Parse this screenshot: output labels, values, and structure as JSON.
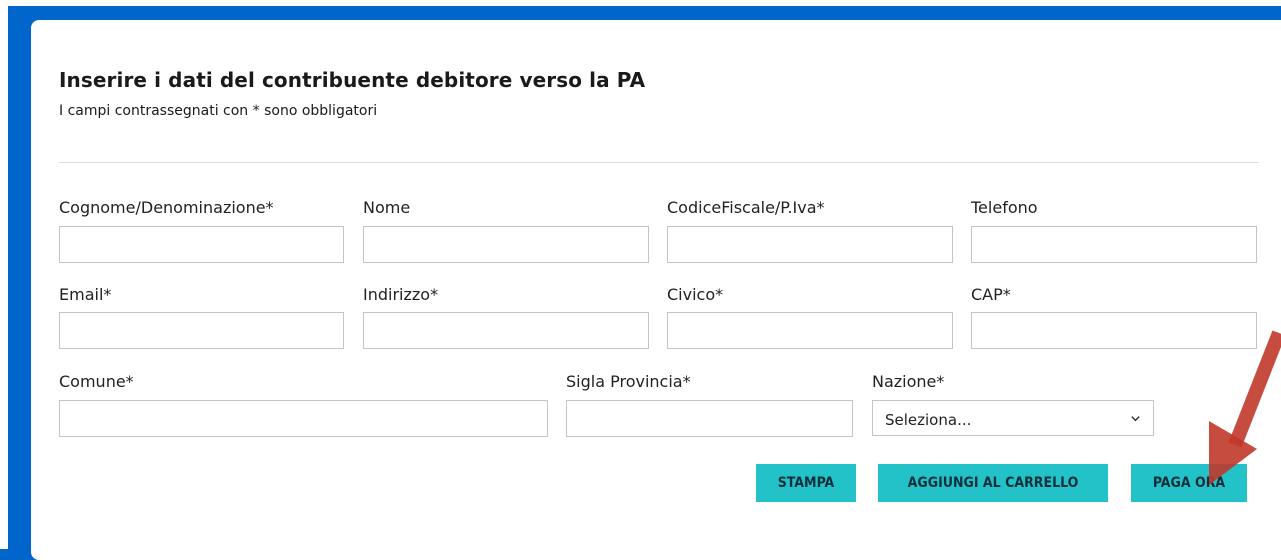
{
  "form": {
    "title": "Inserire i dati del contribuente debitore verso la PA",
    "subtitle": "I campi contrassegnati con * sono obbligatori",
    "labels": {
      "cognome": "Cognome/Denominazione*",
      "nome": "Nome",
      "codice_fiscale": "CodiceFiscale/P.Iva*",
      "telefono": "Telefono",
      "email": "Email*",
      "indirizzo": "Indirizzo*",
      "civico": "Civico*",
      "cap": "CAP*",
      "comune": "Comune*",
      "sigla_provincia": "Sigla Provincia*",
      "nazione": "Nazione*"
    },
    "nazione_select": {
      "selected": "Seleziona..."
    }
  },
  "buttons": {
    "stampa": "STAMPA",
    "aggiungi": "AGGIUNGI AL CARRELLO",
    "paga": "PAGA ORA"
  },
  "colors": {
    "background": "#0066cc",
    "button": "#22c2c8",
    "arrow": "#c0392b"
  }
}
